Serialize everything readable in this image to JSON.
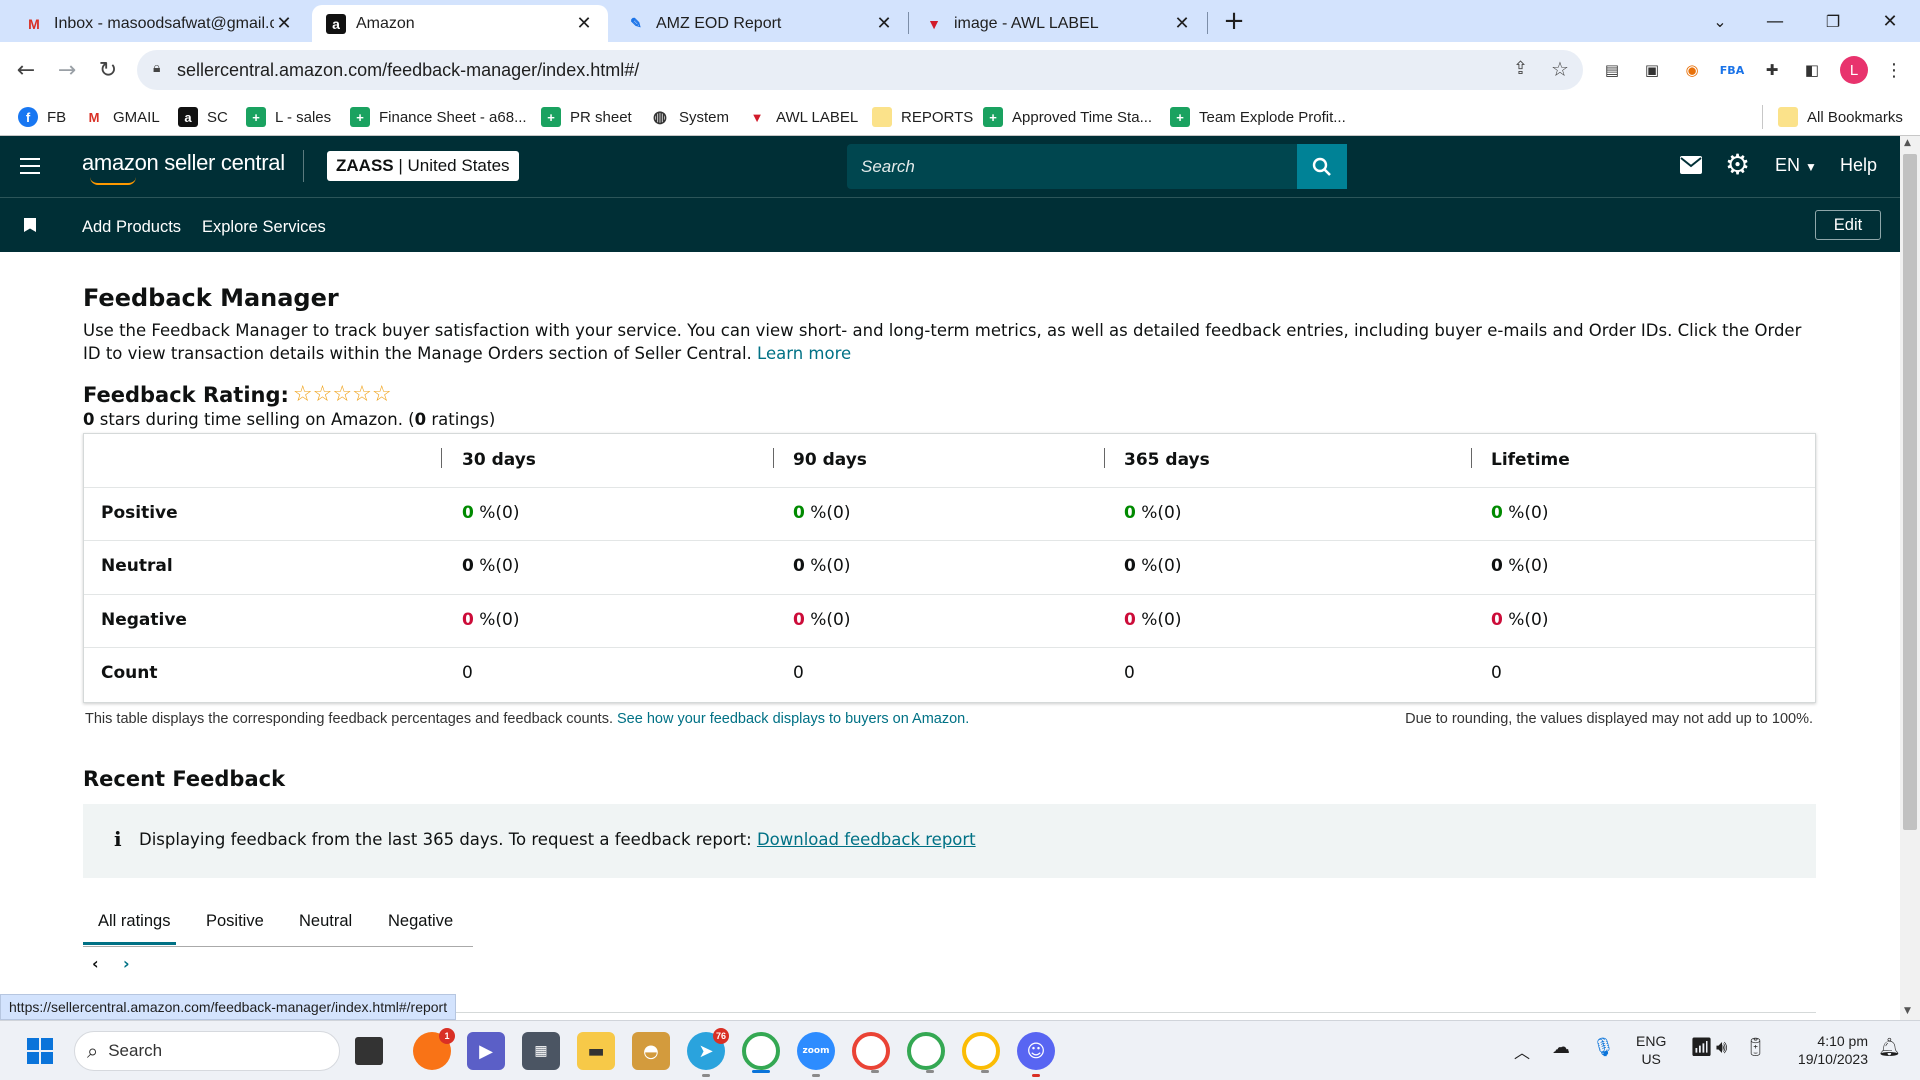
{
  "browser": {
    "tabs": [
      {
        "title": "Inbox - masoodsafwat@gmail.co",
        "icon": "gmail-icon"
      },
      {
        "title": "Amazon",
        "icon": "amazon-icon"
      },
      {
        "title": "AMZ EOD Report",
        "icon": "pen-icon"
      },
      {
        "title": "image - AWL LABEL",
        "icon": "awl-icon"
      }
    ],
    "new_tab": "+",
    "url": "sellercentral.amazon.com/feedback-manager/index.html#/",
    "profile_initial": "L",
    "bookmarks": [
      {
        "label": "FB"
      },
      {
        "label": "GMAIL"
      },
      {
        "label": "SC"
      },
      {
        "label": "L - sales"
      },
      {
        "label": "Finance Sheet - a68..."
      },
      {
        "label": "PR sheet"
      },
      {
        "label": "System"
      },
      {
        "label": "AWL LABEL"
      },
      {
        "label": "REPORTS"
      },
      {
        "label": "Approved Time Sta..."
      },
      {
        "label": "Team Explode Profit..."
      }
    ],
    "all_bookmarks": "All Bookmarks",
    "status_url": "https://sellercentral.amazon.com/feedback-manager/index.html#/report"
  },
  "header": {
    "logo_text": "amazon seller central",
    "store_name": "ZAASS",
    "store_sep": " | ",
    "marketplace": "United States",
    "search_placeholder": "Search",
    "language": "EN",
    "help": "Help"
  },
  "subnav": {
    "items": [
      "Add Products",
      "Explore Services"
    ],
    "edit": "Edit"
  },
  "page": {
    "title": "Feedback Manager",
    "description": "Use the Feedback Manager to track buyer satisfaction with your service. You can view short- and long-term metrics, as well as detailed feedback entries, including buyer e-mails and Order IDs. Click the Order ID to view transaction details within the Manage Orders section of Seller Central.",
    "learn_more": "Learn more",
    "rating_label": "Feedback Rating:",
    "stars_count": 0,
    "stars_max": 5,
    "rating_summary": {
      "stars": "0",
      "mid": " stars during time selling on Amazon. (",
      "ratings": "0",
      "end": " ratings)"
    },
    "table": {
      "columns": [
        "30 days",
        "90 days",
        "365 days",
        "Lifetime"
      ],
      "rows": [
        {
          "label": "Positive",
          "cells": [
            {
              "v": "0",
              "s": " %(0)"
            },
            {
              "v": "0",
              "s": " %(0)"
            },
            {
              "v": "0",
              "s": " %(0)"
            },
            {
              "v": "0",
              "s": " %(0)"
            }
          ]
        },
        {
          "label": "Neutral",
          "cells": [
            {
              "v": "0",
              "s": " %(0)"
            },
            {
              "v": "0",
              "s": " %(0)"
            },
            {
              "v": "0",
              "s": " %(0)"
            },
            {
              "v": "0",
              "s": " %(0)"
            }
          ]
        },
        {
          "label": "Negative",
          "cells": [
            {
              "v": "0",
              "s": " %(0)"
            },
            {
              "v": "0",
              "s": " %(0)"
            },
            {
              "v": "0",
              "s": " %(0)"
            },
            {
              "v": "0",
              "s": " %(0)"
            }
          ]
        },
        {
          "label": "Count",
          "cells": [
            {
              "v": "0",
              "s": ""
            },
            {
              "v": "0",
              "s": ""
            },
            {
              "v": "0",
              "s": ""
            },
            {
              "v": "0",
              "s": ""
            }
          ]
        }
      ]
    },
    "table_note": "This table displays the corresponding feedback percentages and feedback counts.",
    "table_note_link": "See how your feedback displays to buyers on Amazon.",
    "rounding_note": "Due to rounding, the values displayed may not add up to 100%.",
    "recent_title": "Recent Feedback",
    "info_text": "Displaying feedback from the last 365 days. To request a feedback report:",
    "info_link": "Download feedback report",
    "filter_tabs": [
      "All ratings",
      "Positive",
      "Neutral",
      "Negative"
    ],
    "active_filter": "All ratings"
  },
  "taskbar": {
    "search_label": "Search",
    "badges": {
      "orange": "1",
      "telegram": "76"
    },
    "language": "ENG",
    "region": "US",
    "time": "4:10 pm",
    "date": "19/10/2023"
  },
  "colors": {
    "header_bg": "#002f36",
    "search_bg": "#00464f",
    "search_btn": "#008296",
    "link": "#007185",
    "positive": "#008a00",
    "negative": "#cc0c39",
    "star": "#f0a21a"
  }
}
